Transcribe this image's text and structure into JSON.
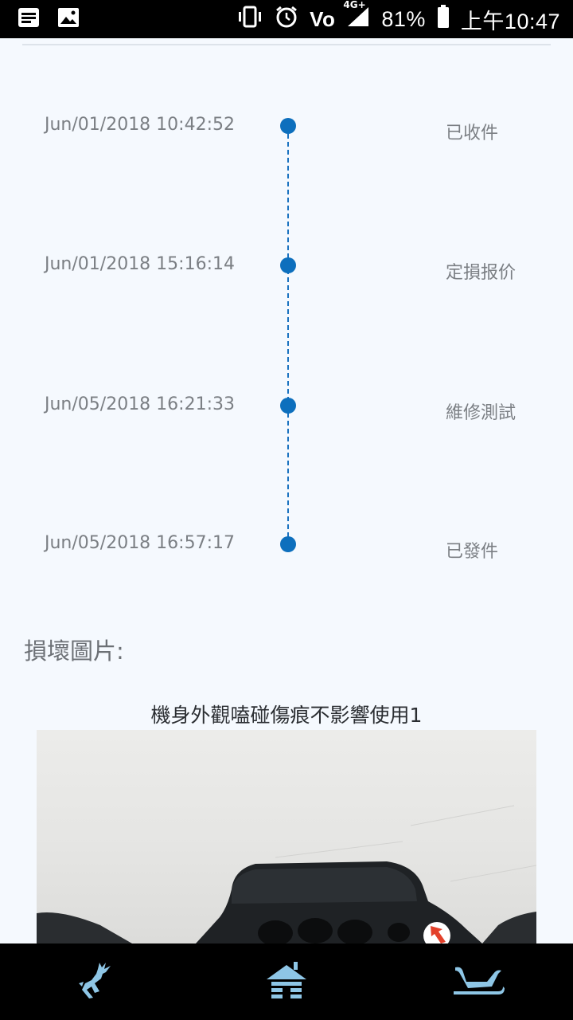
{
  "status_bar": {
    "signal_label": "4G+",
    "battery": "81%",
    "time": "上午10:47",
    "volte_label": "Vo"
  },
  "timeline": {
    "events": [
      {
        "time": "Jun/01/2018 10:42:52",
        "status": "已收件"
      },
      {
        "time": "Jun/01/2018 15:16:14",
        "status": "定損报价"
      },
      {
        "time": "Jun/05/2018 16:21:33",
        "status": "維修測試"
      },
      {
        "time": "Jun/05/2018 16:57:17",
        "status": "已發件"
      }
    ],
    "accent_color": "#0d6fbd"
  },
  "damage": {
    "section_title": "損壞圖片:",
    "photos": [
      {
        "caption": "機身外觀嗑碰傷痕不影響使用1"
      }
    ]
  },
  "bottom_nav": {
    "items": [
      {
        "icon": "deer-icon"
      },
      {
        "icon": "home-icon"
      },
      {
        "icon": "sleigh-icon"
      }
    ],
    "icon_color": "#8ec6e6"
  }
}
